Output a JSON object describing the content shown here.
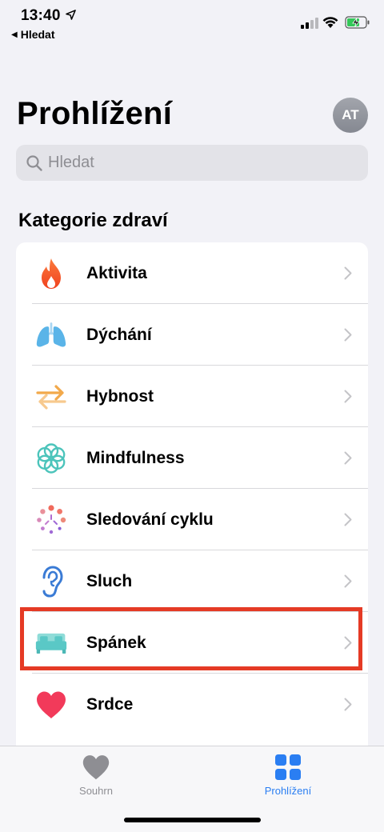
{
  "status_bar": {
    "time": "13:40",
    "back_app": "Hledat"
  },
  "header": {
    "title": "Prohlížení",
    "avatar_initials": "AT"
  },
  "search": {
    "placeholder": "Hledat"
  },
  "section": {
    "title": "Kategorie zdraví"
  },
  "categories": [
    {
      "label": "Aktivita",
      "icon": "flame-icon"
    },
    {
      "label": "Dýchání",
      "icon": "lungs-icon"
    },
    {
      "label": "Hybnost",
      "icon": "arrows-icon"
    },
    {
      "label": "Mindfulness",
      "icon": "flower-icon"
    },
    {
      "label": "Sledování cyklu",
      "icon": "cycle-dots-icon"
    },
    {
      "label": "Sluch",
      "icon": "ear-icon"
    },
    {
      "label": "Spánek",
      "icon": "bed-icon"
    },
    {
      "label": "Srdce",
      "icon": "heart-icon"
    }
  ],
  "highlighted_category": "Spánek",
  "tab_bar": {
    "tabs": [
      {
        "label": "Souhrn",
        "icon": "heart-icon",
        "active": false
      },
      {
        "label": "Prohlížení",
        "icon": "grid-icon",
        "active": true
      }
    ]
  },
  "colors": {
    "background": "#f2f2f7",
    "accent": "#2a7ef2",
    "highlight": "#e53a25",
    "activity": "#f2542d",
    "respiratory": "#5ab4e8",
    "mobility": "#f2a94a",
    "mindfulness": "#4cc4bb",
    "hearing": "#3a7bd5",
    "sleep": "#5ac8c6",
    "heart": "#f23a5a"
  }
}
